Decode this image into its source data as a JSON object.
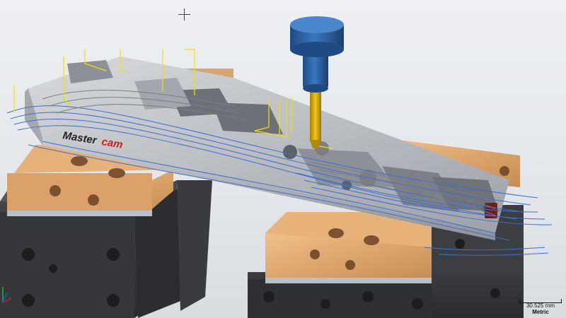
{
  "brand": {
    "logo_text_a": "Master",
    "logo_text_b": "cam"
  },
  "viewport": {
    "scale_value": "30.525 mm",
    "scale_unit": "Metric"
  },
  "colors": {
    "background": "#e6e8ec",
    "vise_body": "#3c3d40",
    "jaw": "#d9a066",
    "part": "#b9bcc1",
    "toolpath_blue": "#3a6fd0",
    "toolpath_yellow": "#f2e000",
    "tool_holder": "#2f63a3",
    "tool_bit": "#e0b400",
    "logo_red": "#c81e1e"
  },
  "icons": {
    "cursor": "crosshair-icon",
    "axis": "axis-indicator-icon"
  }
}
